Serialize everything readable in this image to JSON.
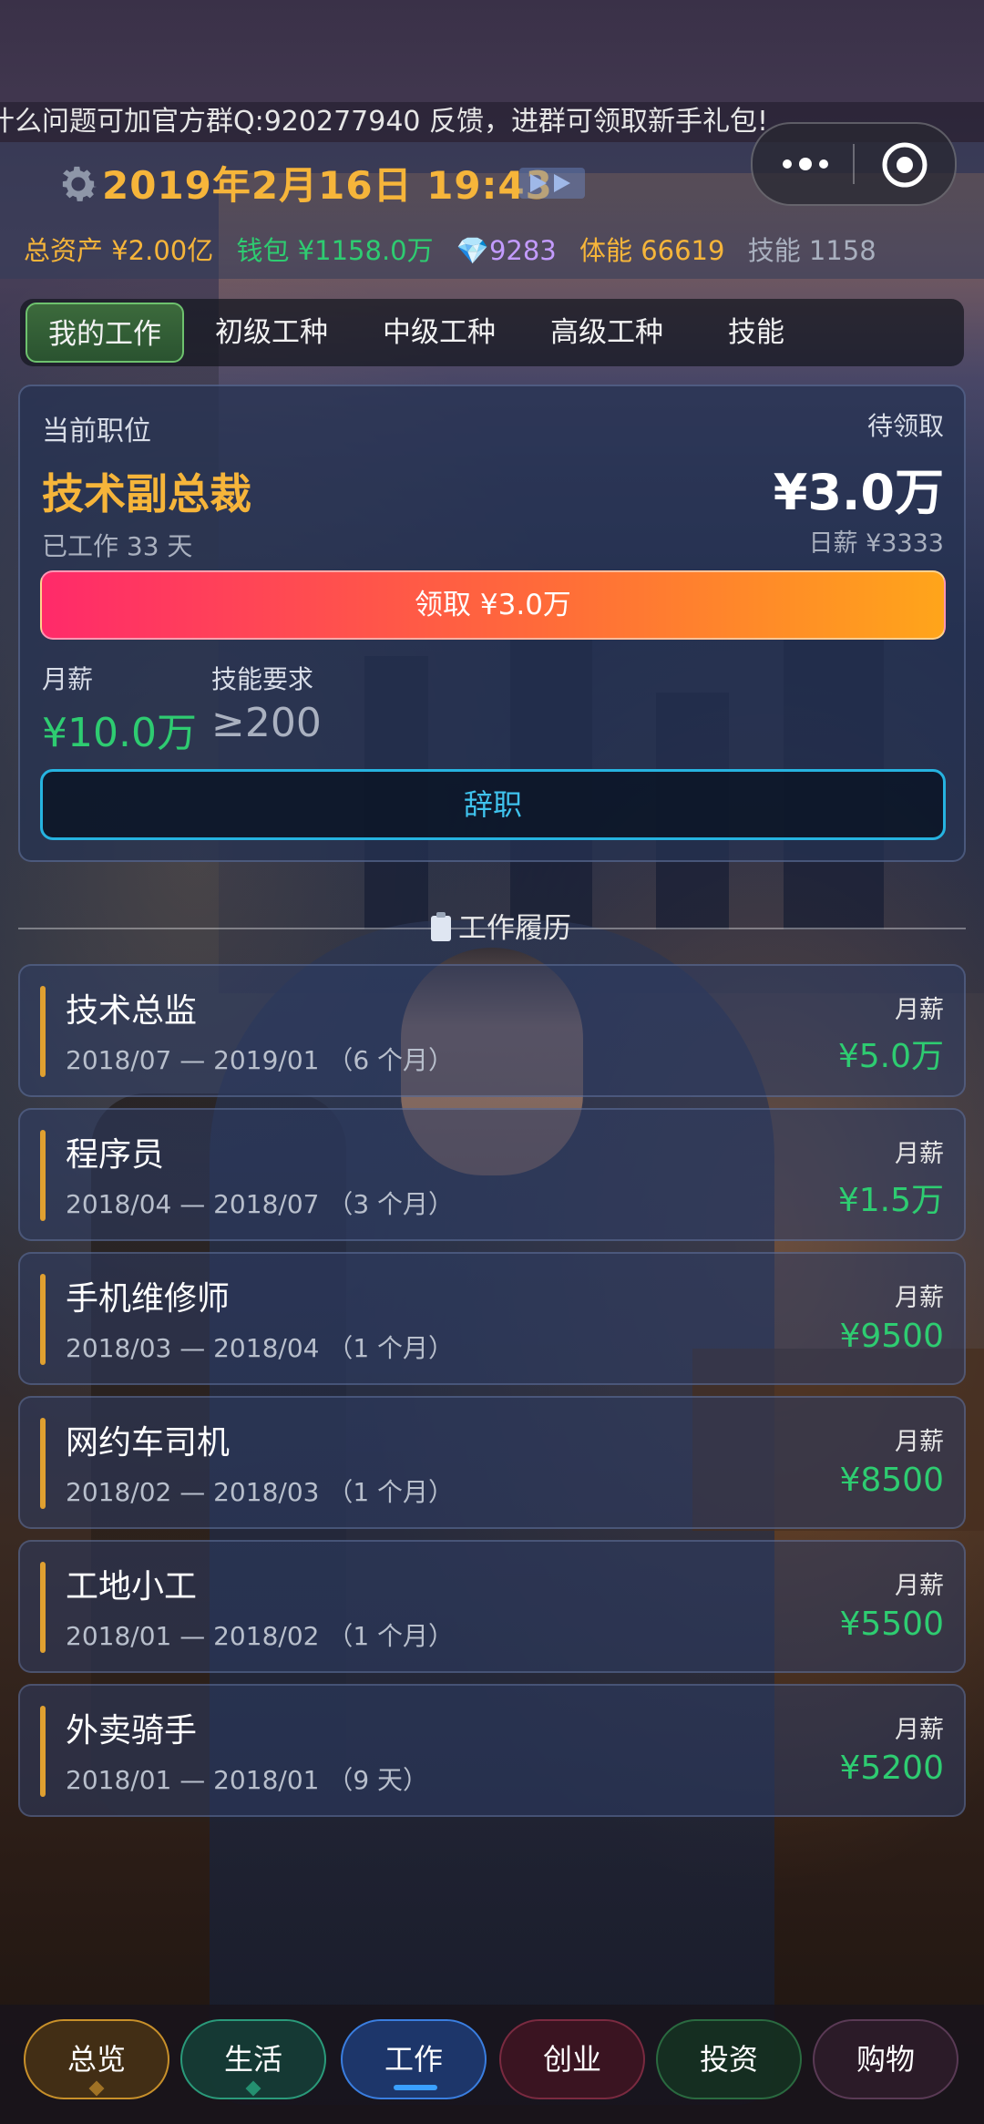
{
  "marquee": {
    "text": "什么问题可加官方群Q:920277940 反馈，进群可领取新手礼包!"
  },
  "header": {
    "datetime": "2019年2月16日 19:43",
    "stats": {
      "total_assets": "总资产 ¥2.00亿",
      "wallet": "钱包 ¥1158.0万",
      "diamonds": "💎9283",
      "stamina": "体能 66619",
      "skill": "技能 1158"
    }
  },
  "tabs": [
    "我的工作",
    "初级工种",
    "中级工种",
    "高级工种",
    "技能"
  ],
  "job": {
    "position_label": "当前职位",
    "title": "技术副总裁",
    "worked": "已工作 33 天",
    "pending_label": "待领取",
    "pending_amount": "¥3.0万",
    "daily_salary": "日薪 ¥3333",
    "claim_button": "领取 ¥3.0万",
    "monthly_label": "月薪",
    "monthly_value": "¥10.0万",
    "skill_req_label": "技能要求",
    "skill_req_value": "≥200",
    "resign_button": "辞职"
  },
  "history": {
    "title": "工作履历",
    "items": [
      {
        "name": "技术总监",
        "period": "2018/07 — 2019/01 （6 个月）",
        "salary_label": "月薪",
        "salary": "¥5.0万"
      },
      {
        "name": "程序员",
        "period": "2018/04 — 2018/07 （3 个月）",
        "salary_label": "月薪",
        "salary": "¥1.5万"
      },
      {
        "name": "手机维修师",
        "period": "2018/03 — 2018/04 （1 个月）",
        "salary_label": "月薪",
        "salary": "¥9500"
      },
      {
        "name": "网约车司机",
        "period": "2018/02 — 2018/03 （1 个月）",
        "salary_label": "月薪",
        "salary": "¥8500"
      },
      {
        "name": "工地小工",
        "period": "2018/01 — 2018/02 （1 个月）",
        "salary_label": "月薪",
        "salary": "¥5500"
      },
      {
        "name": "外卖骑手",
        "period": "2018/01 — 2018/01 （9 天）",
        "salary_label": "月薪",
        "salary": "¥5200"
      }
    ]
  },
  "bottom_nav": [
    "总览",
    "生活",
    "工作",
    "创业",
    "投资",
    "购物"
  ],
  "colors": {
    "accent_gold": "#f6b53a",
    "accent_green": "#2ecc71",
    "accent_blue": "#26b3e0",
    "claim_gradient_start": "#ff2a6a",
    "claim_gradient_end": "#ffa51a"
  }
}
